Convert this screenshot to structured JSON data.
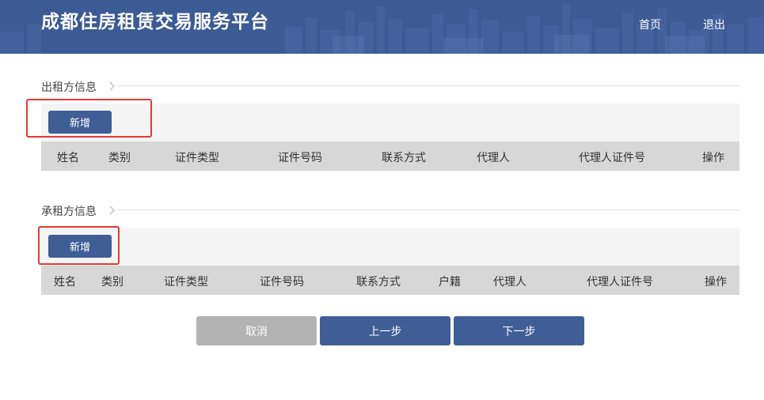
{
  "header": {
    "title": "成都住房租赁交易服务平台",
    "nav": {
      "home": "首页",
      "exit": "退出"
    }
  },
  "landlord": {
    "title": "出租方信息",
    "add_label": "新增",
    "columns": [
      "姓名",
      "类别",
      "证件类型",
      "证件号码",
      "联系方式",
      "代理人",
      "代理人证件号",
      "操作"
    ]
  },
  "tenant": {
    "title": "承租方信息",
    "add_label": "新增",
    "columns": [
      "姓名",
      "类别",
      "证件类型",
      "证件号码",
      "联系方式",
      "户籍",
      "代理人",
      "代理人证件号",
      "操作"
    ]
  },
  "footer": {
    "cancel_label": "取消",
    "prev_label": "上一步",
    "next_label": "下一步"
  },
  "colors": {
    "header_bg": "#3c5a94",
    "primary_button": "#3f5e96",
    "disabled_button": "#b3b3b3",
    "highlight_border": "#e53935",
    "table_header_bg": "#d7d7d7"
  }
}
